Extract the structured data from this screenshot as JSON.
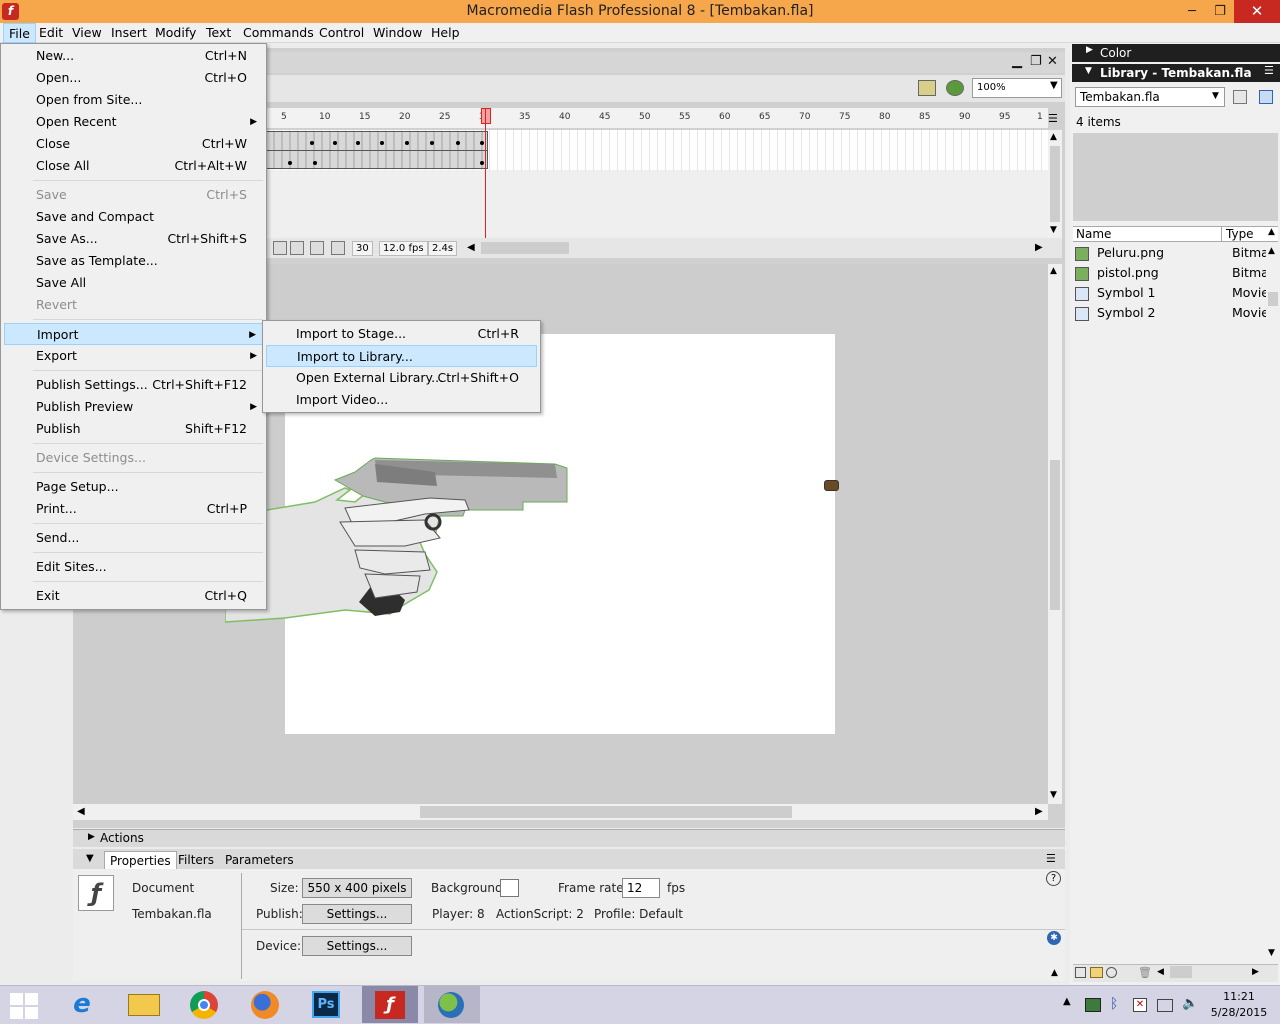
{
  "window": {
    "title": "Macromedia Flash Professional 8 - [Tembakan.fla]",
    "app_logo": "f"
  },
  "menubar": {
    "items": [
      "File",
      "Edit",
      "View",
      "Insert",
      "Modify",
      "Text",
      "Commands",
      "Control",
      "Window",
      "Help"
    ]
  },
  "file_menu": {
    "items": [
      {
        "label": "New...",
        "shortcut": "Ctrl+N"
      },
      {
        "label": "Open...",
        "shortcut": "Ctrl+O"
      },
      {
        "label": "Open from Site...",
        "shortcut": ""
      },
      {
        "label": "Open Recent",
        "shortcut": ""
      },
      {
        "label": "Close",
        "shortcut": "Ctrl+W"
      },
      {
        "label": "Close All",
        "shortcut": "Ctrl+Alt+W"
      },
      {
        "label": "Save",
        "shortcut": "Ctrl+S"
      },
      {
        "label": "Save and Compact",
        "shortcut": ""
      },
      {
        "label": "Save As...",
        "shortcut": "Ctrl+Shift+S"
      },
      {
        "label": "Save as Template...",
        "shortcut": ""
      },
      {
        "label": "Save All",
        "shortcut": ""
      },
      {
        "label": "Revert",
        "shortcut": ""
      },
      {
        "label": "Import",
        "shortcut": ""
      },
      {
        "label": "Export",
        "shortcut": ""
      },
      {
        "label": "Publish Settings...",
        "shortcut": "Ctrl+Shift+F12"
      },
      {
        "label": "Publish Preview",
        "shortcut": ""
      },
      {
        "label": "Publish",
        "shortcut": "Shift+F12"
      },
      {
        "label": "Device Settings...",
        "shortcut": ""
      },
      {
        "label": "Page Setup...",
        "shortcut": ""
      },
      {
        "label": "Print...",
        "shortcut": "Ctrl+P"
      },
      {
        "label": "Send...",
        "shortcut": ""
      },
      {
        "label": "Edit Sites...",
        "shortcut": ""
      },
      {
        "label": "Exit",
        "shortcut": "Ctrl+Q"
      }
    ]
  },
  "import_submenu": {
    "items": [
      {
        "label": "Import to Stage...",
        "shortcut": "Ctrl+R"
      },
      {
        "label": "Import to Library...",
        "shortcut": ""
      },
      {
        "label": "Open External Library...",
        "shortcut": "Ctrl+Shift+O"
      },
      {
        "label": "Import Video...",
        "shortcut": ""
      }
    ]
  },
  "timeline": {
    "ruler": [
      "5",
      "10",
      "15",
      "20",
      "25",
      "30",
      "35",
      "40",
      "45",
      "50",
      "55",
      "60",
      "65",
      "70",
      "75",
      "80",
      "85",
      "90",
      "95",
      "1"
    ],
    "current_frame": "30",
    "fps": "12.0 fps",
    "elapsed": "2.4s",
    "zoom": "100%"
  },
  "properties": {
    "tabs": [
      "Properties",
      "Filters",
      "Parameters"
    ],
    "doc_label": "Document",
    "doc_name": "Tembakan.fla",
    "size_label": "Size:",
    "size_value": "550 x 400 pixels",
    "background_label": "Background:",
    "framerate_label": "Frame rate:",
    "framerate_value": "12",
    "fps_unit": "fps",
    "publish_label": "Publish:",
    "settings_btn": "Settings...",
    "player": "Player: 8",
    "actionscript": "ActionScript:  2",
    "profile": "Profile:  Default",
    "device_label": "Device:",
    "device_btn": "Settings...",
    "actions_label": "Actions",
    "help": "?"
  },
  "color_panel": {
    "title": "Color"
  },
  "library": {
    "title": "Library - Tembakan.fla",
    "selected_doc": "Tembakan.fla",
    "count": "4 items",
    "col_name": "Name",
    "col_type": "Type",
    "items": [
      {
        "name": "Peluru.png",
        "type": "Bitmap"
      },
      {
        "name": "pistol.png",
        "type": "Bitmap"
      },
      {
        "name": "Symbol 1",
        "type": "Movie"
      },
      {
        "name": "Symbol 2",
        "type": "Movie"
      }
    ]
  },
  "taskbar": {
    "apps": [
      "windows-start-icon",
      "ie-icon",
      "explorer-icon",
      "chrome-icon",
      "firefox-icon",
      "photoshop-icon",
      "flash-icon",
      "network-globe-icon"
    ],
    "ps_label": "Ps",
    "time": "11:21",
    "date": "5/28/2015"
  },
  "colors": {
    "titlebar": "#f6a64b",
    "menu_highlight": "#cce8ff",
    "close": "#c7281f"
  }
}
